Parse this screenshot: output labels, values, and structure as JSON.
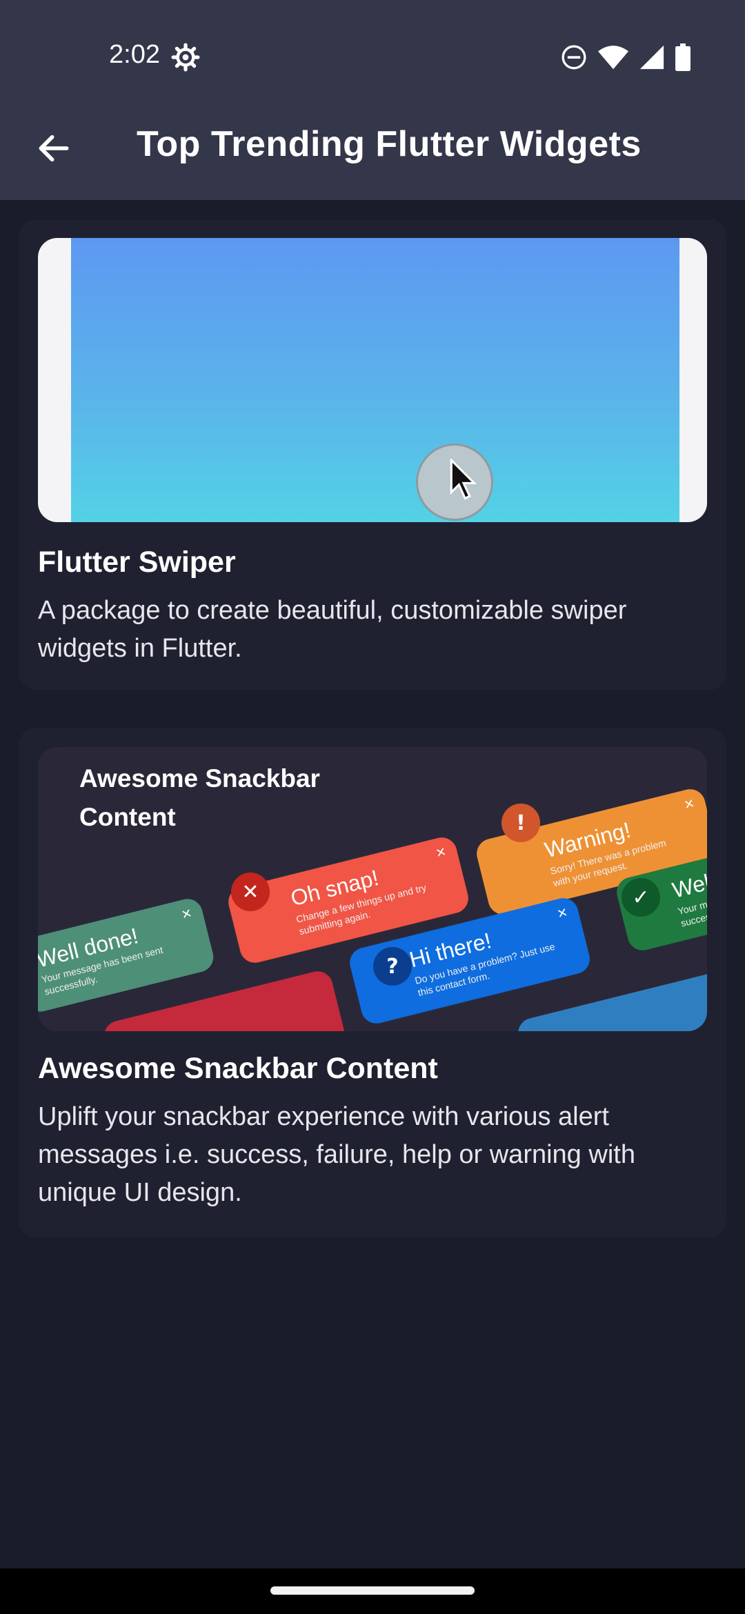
{
  "status_bar": {
    "time": "2:02"
  },
  "app_bar": {
    "title": "Top Trending Flutter Widgets"
  },
  "cards": [
    {
      "title": "Flutter Swiper",
      "description": "A package to create beautiful, customizable swiper widgets in Flutter."
    },
    {
      "title": "Awesome Snackbar Content",
      "description": "Uplift your snackbar experience with various alert messages i.e. success, failure, help or warning with unique UI design.",
      "thumbnail": {
        "heading": "Awesome Snackbar\nContent",
        "snackbars": [
          {
            "title": "Warning!",
            "text": "Sorry! There was a problem with your request.",
            "color": "#ee9135",
            "icon": "!"
          },
          {
            "title": "Oh snap!",
            "text": "Change a few things up and try submitting again.",
            "color": "#f05545",
            "icon": "✕"
          },
          {
            "title": "Well done!",
            "text": "Your message has been sent successfully.",
            "color": "#4e8f77",
            "icon": "✓"
          },
          {
            "title": "Hi there!",
            "text": "Do you have a problem? Just use this contact form.",
            "color": "#0f6ddf",
            "icon": "?"
          },
          {
            "title": "Well",
            "text": "Your mess success",
            "color": "#1f7a3f",
            "icon": "✓"
          }
        ]
      }
    }
  ],
  "colors": {
    "background": "#1b1c29",
    "app_bar": "#34364a",
    "card": "#1f2130"
  }
}
